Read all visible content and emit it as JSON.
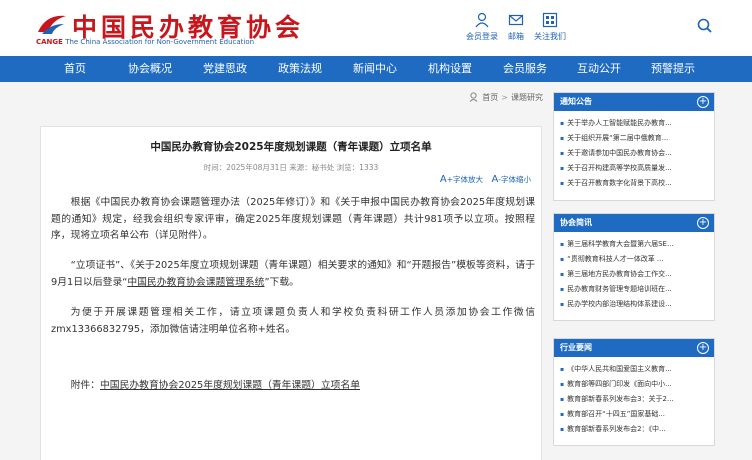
{
  "header": {
    "logo_cn": "中国民办教育协会",
    "logo_en_prefix": "CANGE",
    "logo_en": "The China Association for Non-Government Education",
    "login_label": "会员登录",
    "mail_label": "邮箱",
    "follow_label": "关注我们"
  },
  "nav": [
    "首页",
    "协会概况",
    "党建思政",
    "政策法规",
    "新闻中心",
    "机构设置",
    "会员服务",
    "互动公开",
    "预警提示"
  ],
  "breadcrumb": {
    "home": "首页",
    "sep": ">",
    "current": "课题研究"
  },
  "article": {
    "title": "中国民办教育协会2025年度规划课题（青年课题）立项名单",
    "meta": "时间：2025年08月31日 来源：秘书处 浏览：1333",
    "font_larger": "+字体放大",
    "font_smaller": "-字体缩小",
    "p1": "根据《中国民办教育协会课题管理办法（2025年修订）》和《关于申报中国民办教育协会2025年度规划课题的通知》规定，经我会组织专家评审，确定2025年度规划课题（青年课题）共计981项予以立项。按照程序，现将立项名单公布（详见附件）。",
    "p2_a": "“立项证书”、《关于2025年度立项规划课题（青年课题）相关要求的通知》和“开题报告”模板等资料，请于9月1日以后登录“",
    "p2_link": "中国民办教育协会课题管理系统",
    "p2_b": "”下载。",
    "p3": "为便于开展课题管理相关工作，请立项课题负责人和学校负责科研工作人员添加协会工作微信zmx13366832795，添加微信请注明单位名称+姓名。",
    "attach_label": "附件：",
    "attach_link": "中国民办教育协会2025年度规划课题（青年课题）立项名单"
  },
  "sidebar": {
    "notice": {
      "title": "通知公告",
      "items": [
        "关于举办人工智能赋能民办教育...",
        "关于组织开展“第二届中俄教育...",
        "关于邀请参加中国民办教育协会...",
        "关于召开构建高等学校高质量发...",
        "关于召开教育数字化背景下高校..."
      ]
    },
    "news": {
      "title": "协会简讯",
      "items": [
        "第三届科学教育大会暨第六届SE...",
        "“贯彻教育科技人才一体改革 ...",
        "第三届地方民办教育协会工作交...",
        "民办教育财务管理专题培训班在...",
        "民办学校内部治理结构体系建设..."
      ]
    },
    "industry": {
      "title": "行业要闻",
      "items": [
        "《中华人民共和国爱国主义教育...",
        "教育部等四部门印发《面向中小...",
        "教育部新春系列发布会3：关于2...",
        "教育部召开“十四五”国家基础...",
        "教育部新春系列发布会2：《中..."
      ]
    }
  }
}
